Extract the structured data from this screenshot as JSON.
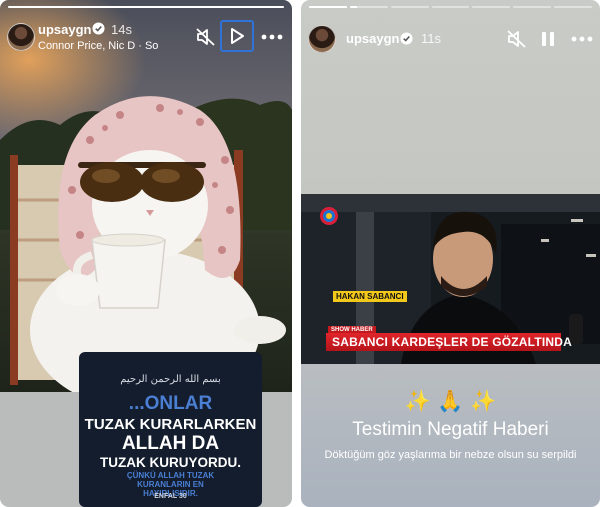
{
  "left_story": {
    "username": "upsaygn",
    "time": "14s",
    "music": "Connor Price, Nic D · So",
    "progress": [
      1
    ],
    "icons": {
      "mute": "speaker-muted-icon",
      "play": "play-icon",
      "more": "more-horizontal-icon",
      "verified": "verified-badge-icon"
    },
    "quote": {
      "arabic": "بسم الله الرحمن الرحيم",
      "line1": "...ONLAR",
      "line2": "TUZAK KURARLARKEN",
      "line3": "ALLAH DA",
      "line4": "TUZAK KURUYORDU.",
      "line5": "ÇÜNKÜ ALLAH TUZAK KURANLARIN EN HAYIRLISIDIR.",
      "line6": "ENFAL 30"
    }
  },
  "right_story": {
    "username": "upsaygn",
    "time": "11s",
    "progress": [
      1,
      0.2,
      0,
      0,
      0,
      0,
      0
    ],
    "icons": {
      "mute": "speaker-muted-icon",
      "pause": "pause-icon",
      "more": "more-horizontal-icon",
      "verified": "verified-badge-icon"
    },
    "video": {
      "channel_logo": "show-tv-logo",
      "name_tag": "HAKAN SABANCI",
      "lower_third_label": "SHOW HABER",
      "lower_third": "SABANCI KARDEŞLER DE GÖZALTINDA"
    },
    "emojis": {
      "left": "✨",
      "middle": "🙏",
      "right": "✨"
    },
    "headline": "Testimin Negatif Haberi",
    "subline": "Döktüğüm göz yaşlarıma bir nebze olsun su serpildi"
  },
  "colors": {
    "highlight_border": "#2f73d9",
    "quote_card_bg": "#141d2d",
    "quote_accent": "#4a7fd4",
    "ticker_red": "#c2191e",
    "name_tag_yellow": "#f2c81b"
  }
}
